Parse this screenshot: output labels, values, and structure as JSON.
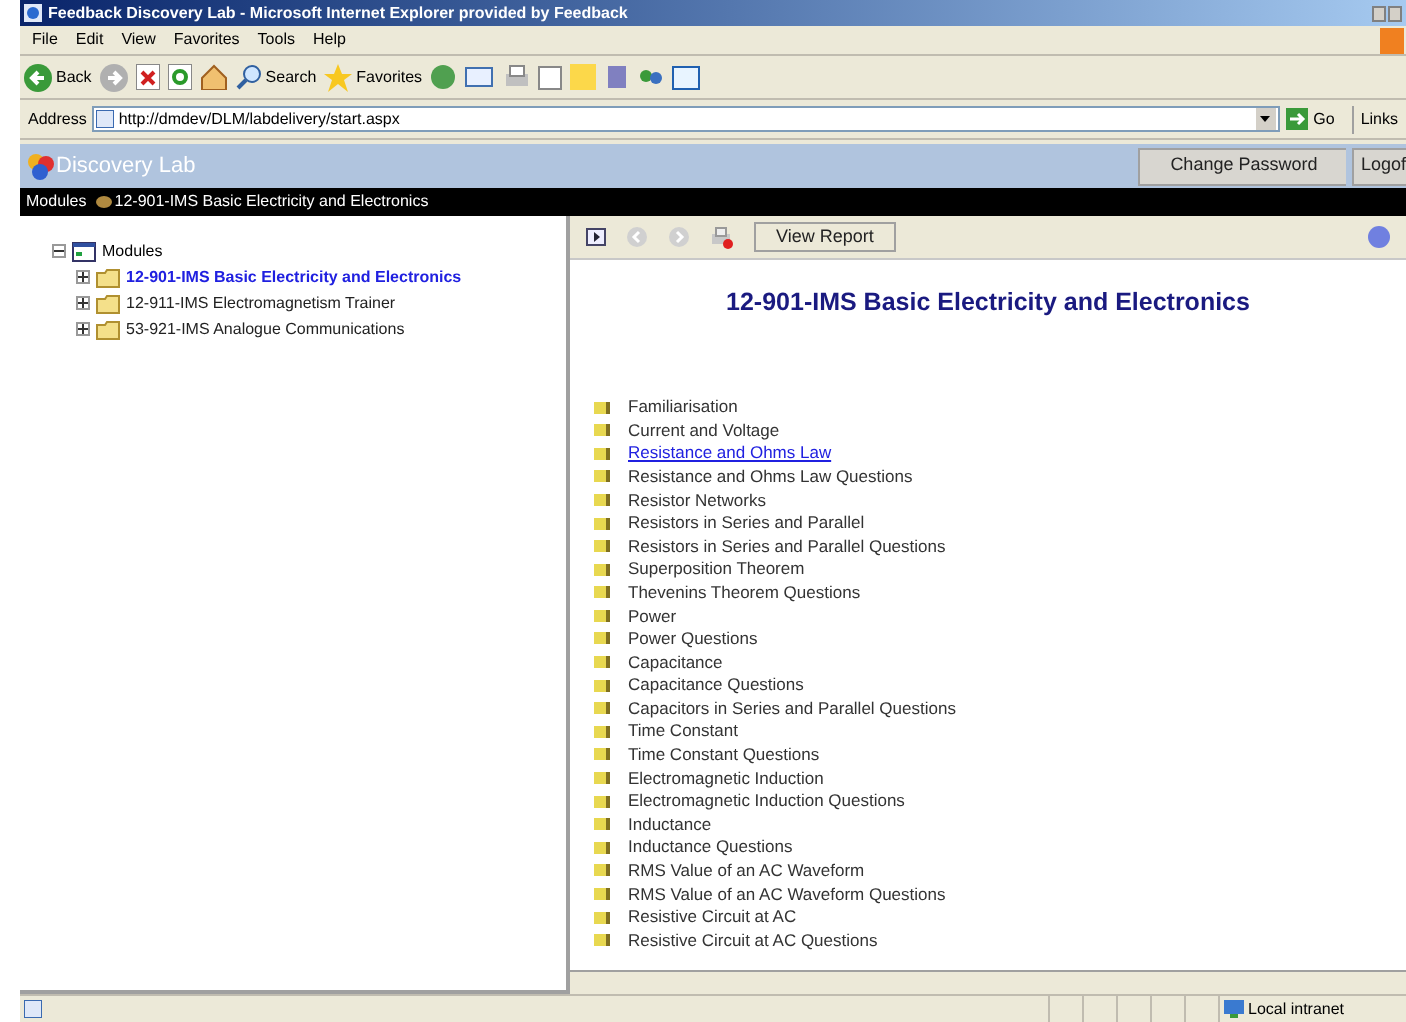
{
  "window": {
    "title": "Feedback Discovery Lab - Microsoft Internet Explorer provided by Feedback"
  },
  "menu": [
    "File",
    "Edit",
    "View",
    "Favorites",
    "Tools",
    "Help"
  ],
  "toolbar": {
    "back": "Back",
    "search": "Search",
    "favorites": "Favorites"
  },
  "address_bar": {
    "label": "Address",
    "value": "http://dmdev/DLM/labdelivery/start.aspx",
    "go": "Go",
    "links": "Links"
  },
  "app_header": {
    "title": "Discovery Lab",
    "buttons": [
      "Change Password",
      "Logof"
    ]
  },
  "breadcrumb": {
    "root": "Modules",
    "current": "12-901-IMS Basic Electricity and Electronics"
  },
  "tree": {
    "label": "Modules",
    "expanded": true,
    "children": [
      {
        "label": "12-901-IMS Basic Electricity and Electronics",
        "selected": true,
        "expanded": false
      },
      {
        "label": "12-911-IMS Electromagnetism Trainer",
        "selected": false,
        "expanded": false
      },
      {
        "label": "53-921-IMS Analogue Communications",
        "selected": false,
        "expanded": false
      }
    ]
  },
  "content_toolbar": {
    "button": "View Report"
  },
  "content": {
    "title": "12-901-IMS Basic Electricity and Electronics",
    "topics": [
      {
        "label": "Familiarisation",
        "hovered": false
      },
      {
        "label": "Current and Voltage",
        "hovered": false
      },
      {
        "label": "Resistance and Ohms Law",
        "hovered": true
      },
      {
        "label": "Resistance and Ohms Law Questions",
        "hovered": false
      },
      {
        "label": "Resistor Networks",
        "hovered": false
      },
      {
        "label": "Resistors in Series and Parallel",
        "hovered": false
      },
      {
        "label": "Resistors in Series and Parallel Questions",
        "hovered": false
      },
      {
        "label": "Superposition Theorem",
        "hovered": false
      },
      {
        "label": "Thevenins Theorem Questions",
        "hovered": false
      },
      {
        "label": "Power",
        "hovered": false
      },
      {
        "label": "Power Questions",
        "hovered": false
      },
      {
        "label": "Capacitance",
        "hovered": false
      },
      {
        "label": "Capacitance Questions",
        "hovered": false
      },
      {
        "label": "Capacitors in Series and Parallel Questions",
        "hovered": false
      },
      {
        "label": "Time Constant",
        "hovered": false
      },
      {
        "label": "Time Constant Questions",
        "hovered": false
      },
      {
        "label": "Electromagnetic Induction",
        "hovered": false
      },
      {
        "label": "Electromagnetic Induction Questions",
        "hovered": false
      },
      {
        "label": "Inductance",
        "hovered": false
      },
      {
        "label": "Inductance Questions",
        "hovered": false
      },
      {
        "label": "RMS Value of an AC Waveform",
        "hovered": false
      },
      {
        "label": "RMS Value of an AC Waveform Questions",
        "hovered": false
      },
      {
        "label": "Resistive Circuit at AC",
        "hovered": false
      },
      {
        "label": "Resistive Circuit at AC Questions",
        "hovered": false
      }
    ]
  },
  "status_bar": {
    "zone": "Local intranet"
  }
}
